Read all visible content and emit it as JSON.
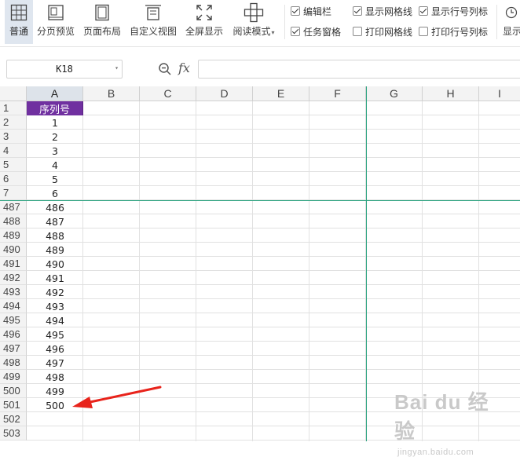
{
  "ribbon": {
    "view_buttons": [
      {
        "label": "普通",
        "icon": "grid-normal-icon"
      },
      {
        "label": "分页预览",
        "icon": "page-break-preview-icon"
      },
      {
        "label": "页面布局",
        "icon": "page-layout-icon"
      },
      {
        "label": "自定义视图",
        "icon": "custom-view-icon"
      },
      {
        "label": "全屏显示",
        "icon": "fullscreen-icon"
      },
      {
        "label": "阅读模式",
        "icon": "reading-mode-icon"
      }
    ],
    "checkboxes": [
      {
        "label": "编辑栏",
        "checked": true
      },
      {
        "label": "任务窗格",
        "checked": true
      },
      {
        "label": "显示网格线",
        "checked": true
      },
      {
        "label": "打印网格线",
        "checked": false
      },
      {
        "label": "显示行号列标",
        "checked": true
      },
      {
        "label": "打印行号列标",
        "checked": false
      }
    ],
    "partial_button": {
      "label": "显示"
    }
  },
  "formula_bar": {
    "name_box": "K18",
    "fx_label": "fx",
    "formula_value": ""
  },
  "grid": {
    "columns": [
      "A",
      "B",
      "C",
      "D",
      "E",
      "F",
      "G",
      "H",
      "I"
    ],
    "selected_column": "A",
    "header_cell": "序列号",
    "header_fill": "#7030a0",
    "rows": [
      {
        "row": "1",
        "value": "序列号"
      },
      {
        "row": "2",
        "value": "1"
      },
      {
        "row": "3",
        "value": "2"
      },
      {
        "row": "4",
        "value": "3"
      },
      {
        "row": "5",
        "value": "4"
      },
      {
        "row": "6",
        "value": "5"
      },
      {
        "row": "7",
        "value": "6"
      },
      {
        "row": "487",
        "value": "486"
      },
      {
        "row": "488",
        "value": "487"
      },
      {
        "row": "489",
        "value": "488"
      },
      {
        "row": "490",
        "value": "489"
      },
      {
        "row": "491",
        "value": "490"
      },
      {
        "row": "492",
        "value": "491"
      },
      {
        "row": "493",
        "value": "492"
      },
      {
        "row": "494",
        "value": "493"
      },
      {
        "row": "495",
        "value": "494"
      },
      {
        "row": "496",
        "value": "495"
      },
      {
        "row": "497",
        "value": "496"
      },
      {
        "row": "498",
        "value": "497"
      },
      {
        "row": "499",
        "value": "498"
      },
      {
        "row": "500",
        "value": "499"
      },
      {
        "row": "501",
        "value": "500"
      },
      {
        "row": "502",
        "value": ""
      },
      {
        "row": "503",
        "value": ""
      }
    ],
    "freeze_line_color": "#2aa37f",
    "annotation_arrow_color": "#e8231b"
  },
  "watermark": {
    "main": "Bai du 经验",
    "sub": "jingyan.baidu.com"
  }
}
